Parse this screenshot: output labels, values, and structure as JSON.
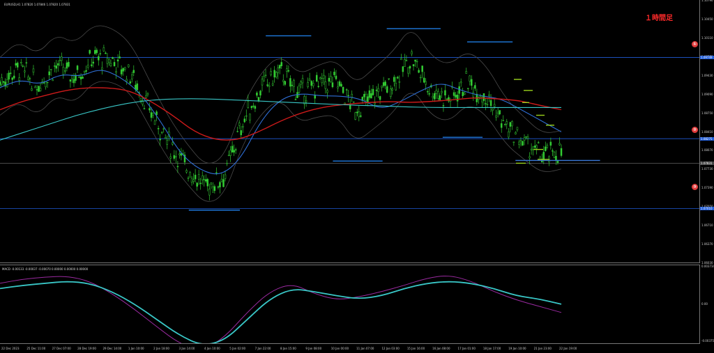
{
  "window": {
    "main_header": "EURUSD,H1  1.07820 1.07846 1.07820 1.07831",
    "macd_header": "MACD -0.00133 -0.00037 -0.00070 0.00000 0.00000 0.00000",
    "annotation": "１時間足",
    "circle_labels": [
      "①",
      "②",
      "③"
    ]
  },
  "y_axis_main": [
    "1.10790",
    "1.10450",
    "1.10110",
    "1.09770",
    "1.09430",
    "1.09090",
    "1.08750",
    "1.08410",
    "1.08070",
    "1.07730",
    "1.07390",
    "1.07050",
    "1.06710",
    "1.06370",
    "1.06030"
  ],
  "y_axis_macd": [
    "0.003734",
    "0.00",
    "-0.003756"
  ],
  "price_badges": [
    "1.09749",
    "1.08275",
    "1.07831",
    "1.07010"
  ],
  "x_axis": [
    "22 Dec 2023",
    "25 Dec 11:00",
    "27 Dec 07:00",
    "28 Dec 19:00",
    "29 Dec 14:00",
    "1 Jan 10:00",
    "2 Jan 18:00",
    "3 Jan 14:00",
    "4 Jan 10:00",
    "5 Jan 02:00",
    "7 Jan 22:00",
    "8 Jan 15:00",
    "9 Jan 08:00",
    "10 Jan 00:00",
    "11 Jan 07:00",
    "12 Jan 03:00",
    "15 Jan 16:00",
    "16 Jan 08:00",
    "17 Jan 01:00",
    "18 Jan 17:00",
    "19 Jan 10:00",
    "21 Jan 23:00",
    "22 Jan 19:00"
  ],
  "colors": {
    "candle": "#33cc33",
    "ma_fast": "#2f6fd6",
    "ma_mid": "#cc1a1a",
    "ma_slow": "#39c7c7",
    "hline": "#1f5bd6",
    "resistance_seg": "#1f7be0",
    "support_ticks": "#9ad21c",
    "bbands": "#4a4a4a",
    "macd_signal": "#39c7c7",
    "macd_main": "#9a2aa0"
  },
  "chart_data": [
    {
      "type": "line",
      "title": "EURUSD,H1",
      "series": [
        {
          "values": [
            1.093,
            1.0955,
            1.0925,
            1.096,
            1.094,
            1.0975,
            1.097,
            1.0945,
            1.088,
            1.082,
            1.0775,
            1.074,
            1.076,
            1.086,
            1.092,
            1.095,
            1.091,
            1.0925,
            1.093,
            1.088,
            1.0905,
            1.093,
            1.0975,
            1.0918,
            1.09,
            1.093,
            1.0905,
            1.085,
            1.082,
            1.0795,
            1.0805
          ]
        },
        {
          "values": [
            1.092,
            1.0935,
            1.0925,
            1.0945,
            1.094,
            1.0955,
            1.094,
            1.091,
            1.086,
            1.08,
            1.077,
            1.076,
            1.079,
            1.086,
            1.09,
            1.091,
            1.0905,
            1.0905,
            1.09,
            1.088,
            1.0895,
            1.0915,
            1.093,
            1.0915,
            1.0905,
            1.09,
            1.088,
            1.086,
            1.084
          ]
        },
        {
          "values": [
            1.088,
            1.0895,
            1.0905,
            1.0915,
            1.092,
            1.092,
            1.0915,
            1.0895,
            1.087,
            1.084,
            1.0825,
            1.0825,
            1.084,
            1.086,
            1.0875,
            1.0885,
            1.089,
            1.0893,
            1.0895,
            1.0893,
            1.0895,
            1.0898,
            1.0902,
            1.09,
            1.0897,
            1.0888,
            1.088
          ]
        },
        {
          "values": [
            1.0825,
            1.084,
            1.0855,
            1.087,
            1.0882,
            1.0892,
            1.0898,
            1.09,
            1.09,
            1.0898,
            1.0896,
            1.0894,
            1.0892,
            1.089,
            1.0888,
            1.0887,
            1.0885,
            1.0884,
            1.0884,
            1.0884,
            1.0884,
            1.0884,
            1.0884
          ]
        }
      ],
      "hlines": [
        1.09749,
        1.08275,
        1.07831,
        1.0701
      ],
      "segments": [
        {
          "y": 1.1014,
          "x0": 0.38,
          "x1": 0.445
        },
        {
          "y": 1.1027,
          "x0": 0.553,
          "x1": 0.63
        },
        {
          "y": 1.1003,
          "x0": 0.668,
          "x1": 0.733
        },
        {
          "y": 1.083,
          "x0": 0.633,
          "x1": 0.69
        },
        {
          "y": 1.0787,
          "x0": 0.476,
          "x1": 0.547
        },
        {
          "y": 1.0698,
          "x0": 0.27,
          "x1": 0.343
        },
        {
          "y": 1.0788,
          "x0": 0.737,
          "x1": 0.858
        }
      ]
    },
    {
      "type": "line",
      "title": "MACD",
      "series": [
        {
          "values": [
            0.0015,
            0.0018,
            0.002,
            0.0022,
            0.002,
            0.0012,
            0.0,
            -0.0015,
            -0.003,
            -0.004,
            -0.0035,
            -0.0015,
            0.0005,
            0.0015,
            0.0012,
            0.0008,
            0.0005,
            0.0008,
            0.0015,
            0.002,
            0.0022,
            0.002,
            0.0015,
            0.0008,
            0.0005,
            0.0
          ]
        },
        {
          "values": [
            0.002,
            0.0024,
            0.0026,
            0.0027,
            0.0022,
            0.001,
            -0.0005,
            -0.0022,
            -0.0038,
            -0.0045,
            -0.0032,
            -0.0008,
            0.0012,
            0.002,
            0.001,
            0.0004,
            0.0007,
            0.0012,
            0.0018,
            0.0025,
            0.0028,
            0.0022,
            0.0012,
            0.0004,
            -0.0002,
            -0.0008
          ]
        }
      ],
      "ylim": [
        -0.003756,
        0.003734
      ]
    }
  ]
}
